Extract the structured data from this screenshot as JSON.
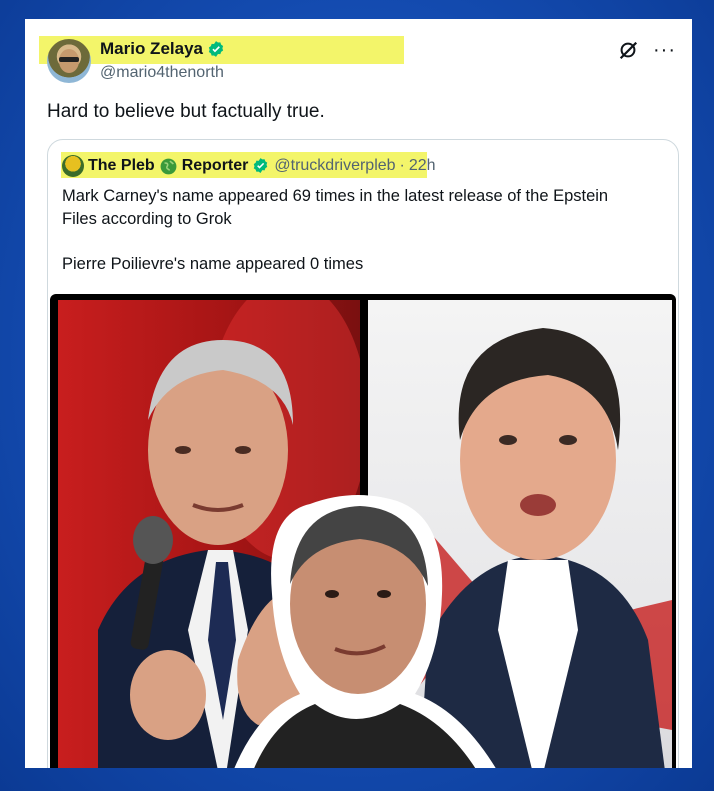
{
  "tweet": {
    "author_name": "Mario Zelaya",
    "author_handle": "@mario4thenorth",
    "text": "Hard to believe but factually true."
  },
  "quoted_tweet": {
    "name_part1": "The Pleb",
    "name_part2": "Reporter",
    "handle": "@truckdriverpleb",
    "separator": "·",
    "time": "22h",
    "line1": "Mark Carney's name appeared 69 times in the latest release of the Epstein",
    "line2": "Files according to Grok",
    "line3": "Pierre Poilievre's name appeared 0 times"
  },
  "icons": {
    "verified": "verified-badge-icon",
    "grok": "grok-icon",
    "more": "more-icon",
    "globe": "globe-icon"
  },
  "colors": {
    "highlight": "#f3f56a",
    "verified": "#00ba7c",
    "text": "#0f1419",
    "muted": "#536471",
    "background": "#1650b8"
  }
}
